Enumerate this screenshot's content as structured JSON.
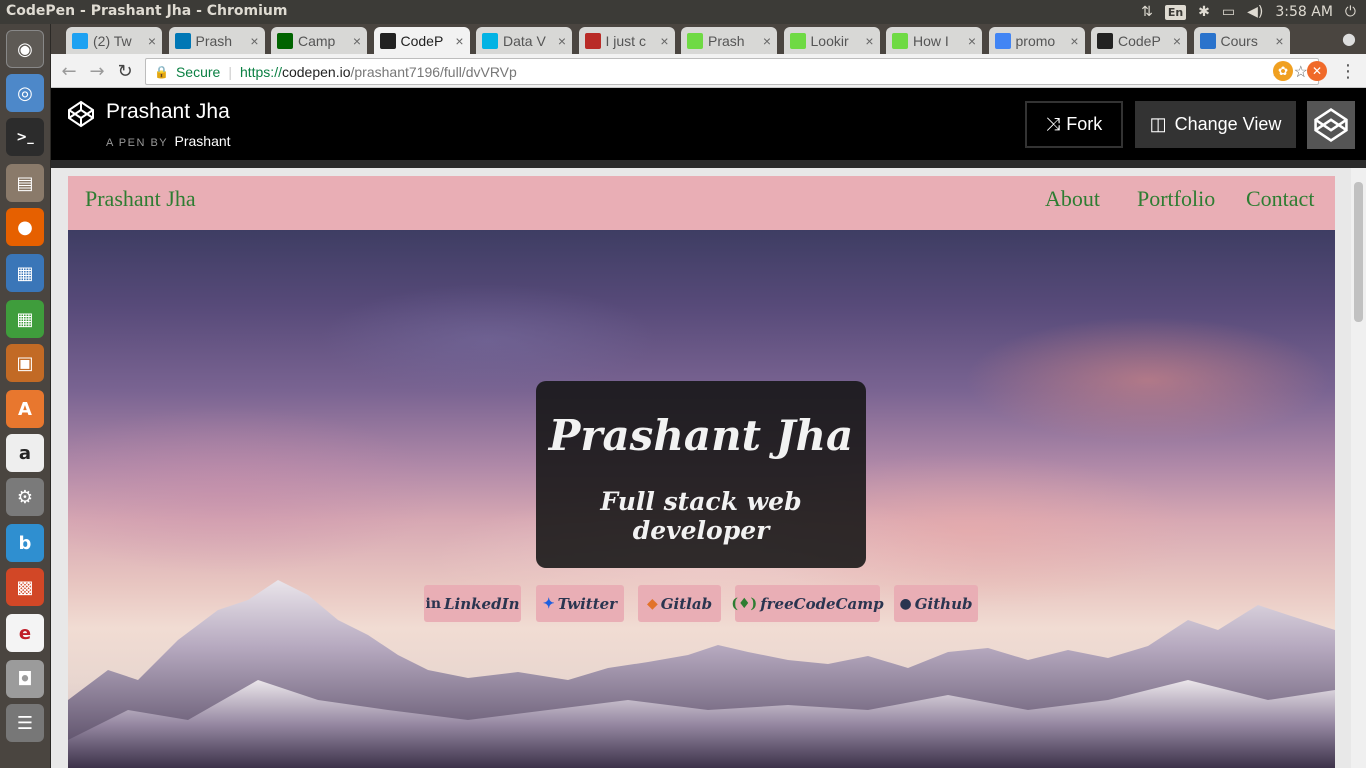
{
  "system": {
    "window_title": "CodePen - Prashant Jha - Chromium",
    "keyboard_layout": "En",
    "clock": "3:58 AM"
  },
  "launcher": {
    "icons": [
      "dash-icon",
      "chromium-icon",
      "terminal-icon",
      "files-icon",
      "firefox-icon",
      "writer-icon",
      "calc-icon",
      "impress-icon",
      "software-center-icon",
      "amazon-icon",
      "settings-icon",
      "bing-icon",
      "office-icon",
      "evolution-icon",
      "camera-icon",
      "workspaces-icon"
    ]
  },
  "browser": {
    "tabs": [
      {
        "label": "(2) Tw",
        "icon": "twitter-icon",
        "color": "#1da1f2",
        "active": false
      },
      {
        "label": "Prash",
        "icon": "linkedin-icon",
        "color": "#0077b5",
        "active": false
      },
      {
        "label": "Camp",
        "icon": "freecodecamp-icon",
        "color": "#006400",
        "active": false
      },
      {
        "label": "CodeP",
        "icon": "codepen-icon",
        "color": "#222222",
        "active": true
      },
      {
        "label": "Data V",
        "icon": "udacity-icon",
        "color": "#02b3e4",
        "active": false
      },
      {
        "label": "I just c",
        "icon": "quora-icon",
        "color": "#b92b27",
        "active": false
      },
      {
        "label": "Prash",
        "icon": "upwork-icon",
        "color": "#6fda44",
        "active": false
      },
      {
        "label": "Lookir",
        "icon": "upwork-icon",
        "color": "#6fda44",
        "active": false
      },
      {
        "label": "How I",
        "icon": "upwork-icon",
        "color": "#6fda44",
        "active": false
      },
      {
        "label": "promo",
        "icon": "google-icon",
        "color": "#4285f4",
        "active": false
      },
      {
        "label": "CodeP",
        "icon": "codepen-icon",
        "color": "#222222",
        "active": false
      },
      {
        "label": "Cours",
        "icon": "coursera-icon",
        "color": "#2a73cc",
        "active": false
      }
    ],
    "secure_label": "Secure",
    "url": {
      "scheme": "https://",
      "host": "codepen.io",
      "path": "/prashant7196/full/dvVRVp"
    }
  },
  "codepen": {
    "pen_title": "Prashant Jha",
    "byline": "A PEN BY",
    "author": "Prashant",
    "fork_label": "Fork",
    "change_view_label": "Change View"
  },
  "site": {
    "brand": "Prashant Jha",
    "nav_links": [
      "About",
      "Portfolio",
      "Contact"
    ],
    "hero_name": "Prashant Jha",
    "hero_role": "Full stack web developer",
    "social": [
      {
        "label": "LinkedIn",
        "icon": "linkedin-icon",
        "glyph": "in"
      },
      {
        "label": "Twitter",
        "icon": "twitter-icon",
        "glyph": "🐦"
      },
      {
        "label": "Gitlab",
        "icon": "gitlab-icon",
        "glyph": "🦊"
      },
      {
        "label": "freeCodeCamp",
        "icon": "freecodecamp-icon",
        "glyph": "(🔥)"
      },
      {
        "label": "Github",
        "icon": "github-icon",
        "glyph": "●"
      }
    ],
    "colors": {
      "nav_bg": "#e9aeb5",
      "link_green": "#2e7d32",
      "card_bg": "#141414"
    }
  }
}
